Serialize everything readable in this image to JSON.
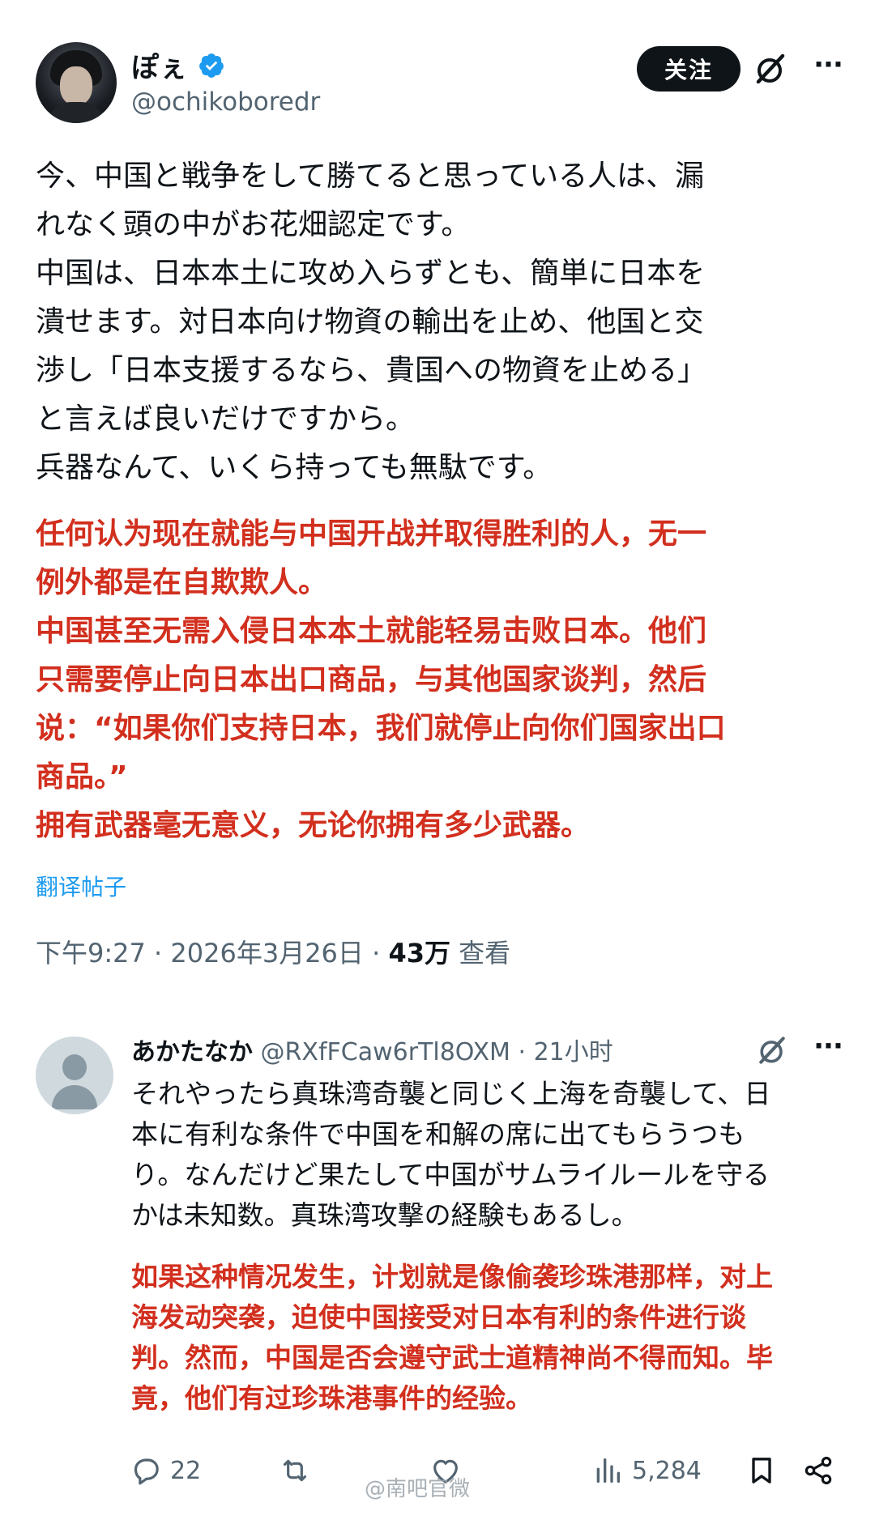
{
  "post": {
    "author": {
      "display_name": "ぽぇ",
      "handle": "@ochikoboredr",
      "verified": true
    },
    "follow_label": "关注",
    "japanese_lines": [
      "今、中国と戦争をして勝てると思っている人は、漏",
      "れなく頭の中がお花畑認定です。",
      "中国は、日本本土に攻め入らずとも、簡単に日本を",
      "潰せます。対日本向け物資の輸出を止め、他国と交",
      "渉し「日本支援するなら、貴国への物資を止める」",
      "と言えば良いだけですから。",
      "兵器なんて、いくら持っても無駄です。"
    ],
    "chinese_lines": [
      "任何认为现在就能与中国开战并取得胜利的人，无一",
      "例外都是在自欺欺人。",
      "中国甚至无需入侵日本本土就能轻易击败日本。他们",
      "只需要停止向日本出口商品，与其他国家谈判，然后",
      "说：“如果你们支持日本，我们就停止向你们国家出口",
      "商品。”",
      "拥有武器毫无意义，无论你拥有多少武器。"
    ],
    "translate_label": "翻译帖子",
    "time": "下午9:27",
    "date": "2026年3月26日",
    "views": "43万",
    "views_label": "查看",
    "separator": "·"
  },
  "reply": {
    "author": {
      "display_name": "あかたなか",
      "handle": "@RXfFCaw6rTl8OXM"
    },
    "time": "21小时",
    "separator": "·",
    "japanese_lines": [
      "それやったら真珠湾奇襲と同じく上海を奇襲して、日",
      "本に有利な条件で中国を和解の席に出てもらうつも",
      "り。なんだけど果たして中国がサムライルールを守る",
      "かは未知数。真珠湾攻撃の経験もあるし。"
    ],
    "chinese_lines": [
      "如果这种情况发生，计划就是像偷袭珍珠港那样，对上",
      "海发动突袭，迫使中国接受对日本有利的条件进行谈",
      "判。然而，中国是否会遵守武士道精神尚不得而知。毕",
      "竟，他们有过珍珠港事件的经验。"
    ]
  },
  "actions": {
    "replies": "22",
    "views": "5,284"
  },
  "watermark": "@南吧官微",
  "colors": {
    "text": "#0f1419",
    "secondary": "#536471",
    "translation_red": "#d22f1e",
    "link_blue": "#1d9bf0",
    "verified_blue": "#1d9bf0"
  },
  "icons": {
    "verified": "verified-badge-icon",
    "grok": "grok-icon",
    "more": "more-icon",
    "reply": "reply-icon",
    "retweet": "retweet-icon",
    "like": "like-icon",
    "views": "views-icon",
    "bookmark": "bookmark-icon",
    "share": "share-icon"
  }
}
